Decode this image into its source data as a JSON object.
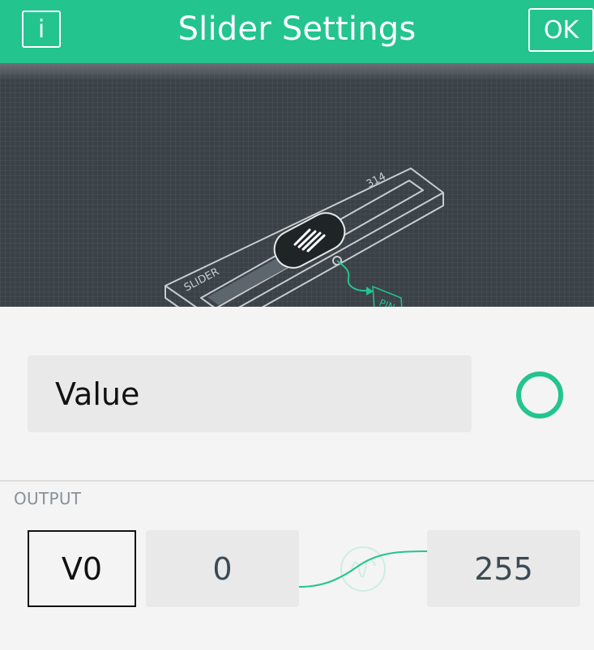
{
  "header": {
    "info_label": "i",
    "title": "Slider Settings",
    "ok_label": "OK"
  },
  "illustration": {
    "slider_text": "SLIDER",
    "value_text": "314",
    "pin_text": "PIN"
  },
  "value_field": {
    "label": "Value"
  },
  "output": {
    "section_label": "OUTPUT",
    "pin": "V0",
    "min": "0",
    "max": "255"
  },
  "colors": {
    "accent": "#23c48e",
    "banner": "#3a4147",
    "field": "#e8e9e8",
    "background": "#f4f4f4"
  },
  "icons": {
    "info": "info-icon",
    "color_picker": "color-ring-icon",
    "mapping": "wave-icon"
  }
}
